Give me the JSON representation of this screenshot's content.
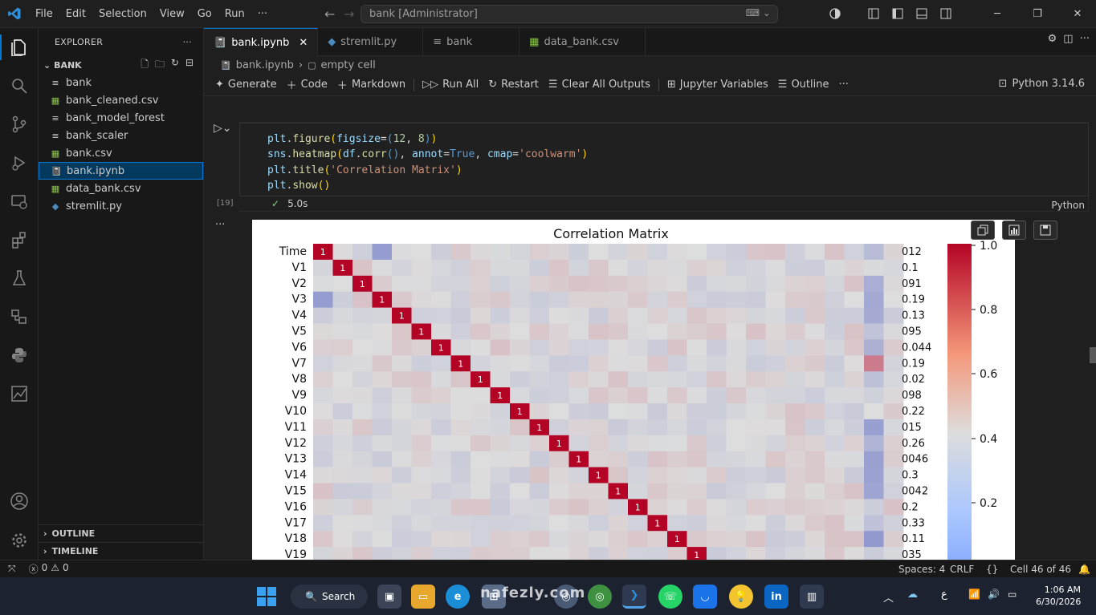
{
  "titlebar": {
    "menus": [
      "File",
      "Edit",
      "Selection",
      "View",
      "Go",
      "Run",
      "···"
    ],
    "search_text": "bank [Administrator]"
  },
  "explorer": {
    "header": "EXPLORER",
    "folder": "BANK",
    "files": [
      {
        "name": "bank",
        "type": "plain"
      },
      {
        "name": "bank_cleaned.csv",
        "type": "csv"
      },
      {
        "name": "bank_model_forest",
        "type": "plain"
      },
      {
        "name": "bank_scaler",
        "type": "plain"
      },
      {
        "name": "bank.csv",
        "type": "csv"
      },
      {
        "name": "bank.ipynb",
        "type": "notebook"
      },
      {
        "name": "data_bank.csv",
        "type": "csv"
      },
      {
        "name": "stremlit.py",
        "type": "python"
      }
    ],
    "outline": "OUTLINE",
    "timeline": "TIMELINE"
  },
  "tabs": [
    {
      "label": "bank.ipynb",
      "icon": "notebook-icon",
      "active": true
    },
    {
      "label": "stremlit.py",
      "icon": "python-icon",
      "active": false
    },
    {
      "label": "bank",
      "icon": "file-icon",
      "active": false
    },
    {
      "label": "data_bank.csv",
      "icon": "csv-icon",
      "active": false
    }
  ],
  "breadcrumb": {
    "file": "bank.ipynb",
    "item": "empty cell"
  },
  "toolbar": {
    "generate": "Generate",
    "code": "Code",
    "markdown": "Markdown",
    "run_all": "Run All",
    "restart": "Restart",
    "clear": "Clear All Outputs",
    "variables": "Jupyter Variables",
    "outline": "Outline",
    "kernel": "Python 3.14.6"
  },
  "cell": {
    "exec_count": "[19]",
    "duration": "5.0s",
    "language": "Python"
  },
  "chart_data": {
    "type": "heatmap",
    "title": "Correlation Matrix",
    "rows": [
      "Time",
      "V1",
      "V2",
      "V3",
      "V4",
      "V5",
      "V6",
      "V7",
      "V8",
      "V9",
      "V10",
      "V11",
      "V12",
      "V13",
      "V14",
      "V15",
      "V16",
      "V17",
      "V18",
      "V19"
    ],
    "colorbar_ticks": [
      "1.0",
      "0.8",
      "0.6",
      "0.4",
      "0.2"
    ],
    "colormap": "coolwarm",
    "diagonal_value": "1",
    "row_tail_labels": [
      "012",
      "0.1",
      "091",
      "0.19",
      "0.13",
      "095",
      "0.044",
      "0.19",
      "0.02",
      "098",
      "0.22",
      "015",
      "0.26",
      "0046",
      "0.3",
      "0042",
      "0.2",
      "0.33",
      "0.11",
      "035"
    ]
  },
  "status": {
    "errors": "0",
    "warnings": "0",
    "spaces": "Spaces: 4",
    "eol": "CRLF",
    "cell": "Cell 46 of 46"
  },
  "taskbar": {
    "search": "Search",
    "time": "1:06 AM",
    "date": "6/30/2026",
    "lang": "ع"
  },
  "watermark": "nafezly.com"
}
